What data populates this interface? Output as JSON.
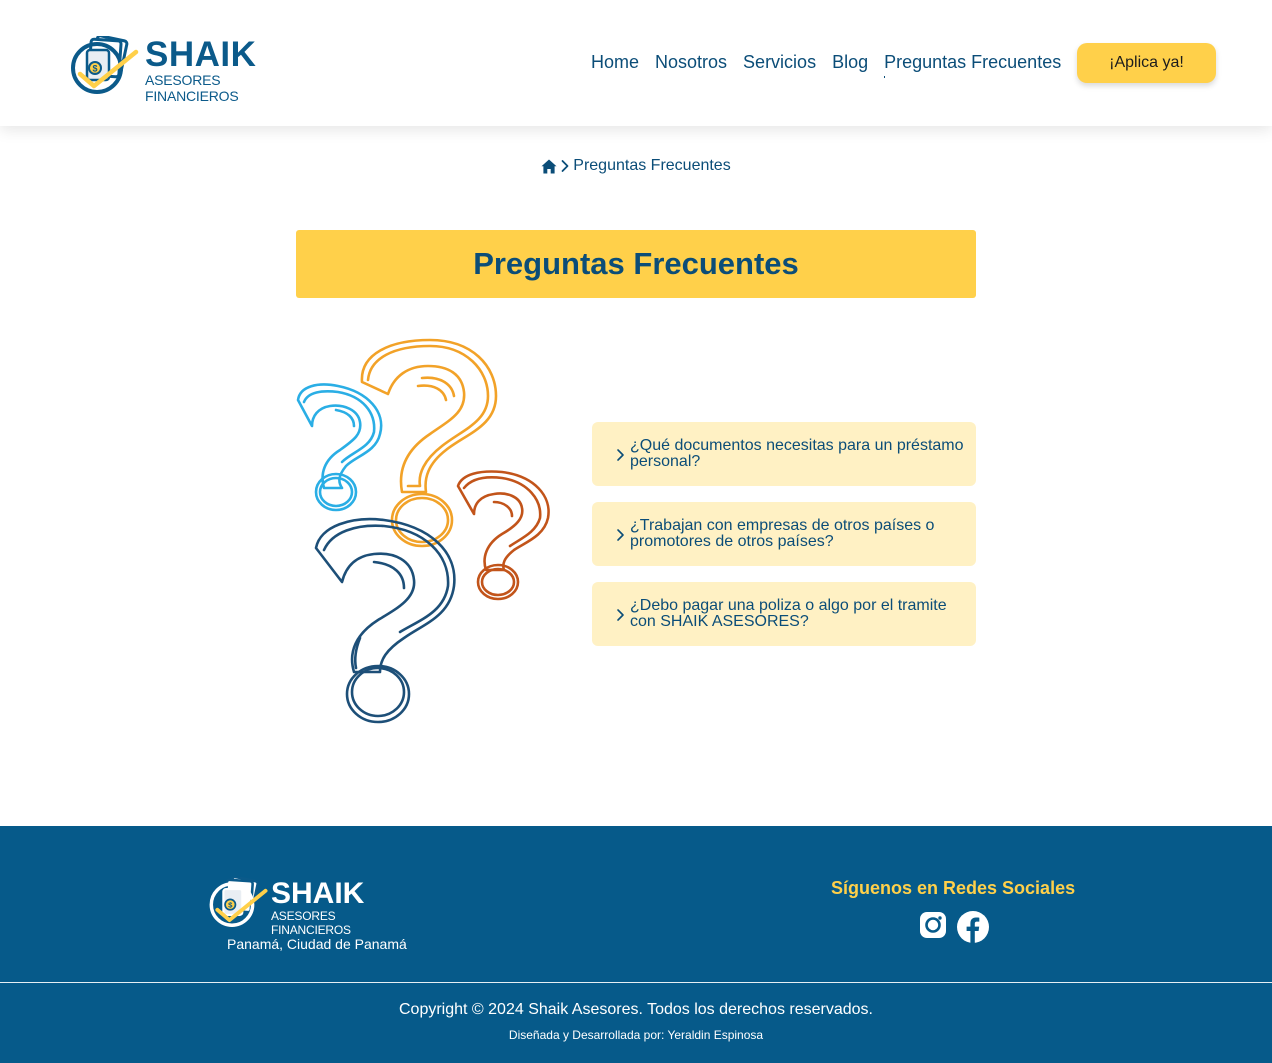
{
  "brand": {
    "name": "SHAIK",
    "subtitle": "ASESORES FINANCIEROS"
  },
  "nav": {
    "items": [
      "Home",
      "Nosotros",
      "Servicios",
      "Blog",
      "Preguntas Frecuentes"
    ],
    "active": "Preguntas Frecuentes",
    "cta_label": "¡Aplica ya!"
  },
  "breadcrumb": {
    "home_icon": "home-icon",
    "separator_icon": "chevron-right-icon",
    "current": "Preguntas Frecuentes"
  },
  "page": {
    "title": "Preguntas Frecuentes"
  },
  "faq": {
    "items": [
      {
        "question": "¿Qué documentos necesitas para un préstamo personal?"
      },
      {
        "question": "¿Trabajan con empresas de otros países o promotores de otros países?"
      },
      {
        "question": "¿Debo pagar una poliza o algo por el tramite con SHAIK ASESORES?"
      }
    ]
  },
  "footer": {
    "brand_name": "SHAIK",
    "brand_subtitle": "ASESORES FINANCIEROS",
    "location": "Panamá, Ciudad de Panamá",
    "social_title": "Síguenos en Redes Sociales",
    "social_icons": [
      "instagram-icon",
      "facebook-icon"
    ],
    "copyright": "Copyright © 2024 Shaik Asesores. Todos los derechos reservados.",
    "credits": "Diseñada y Desarrollada por: Yeraldin Espinosa"
  },
  "colors": {
    "primary": "#0b4d78",
    "accent": "#ffd04a",
    "faq_bg": "#fff1c4",
    "footer_bg": "#065a8a",
    "q_blue_light": "#2aaee5",
    "q_orange": "#f2a228",
    "q_rust": "#c2541a",
    "q_navy": "#1d4f78"
  }
}
